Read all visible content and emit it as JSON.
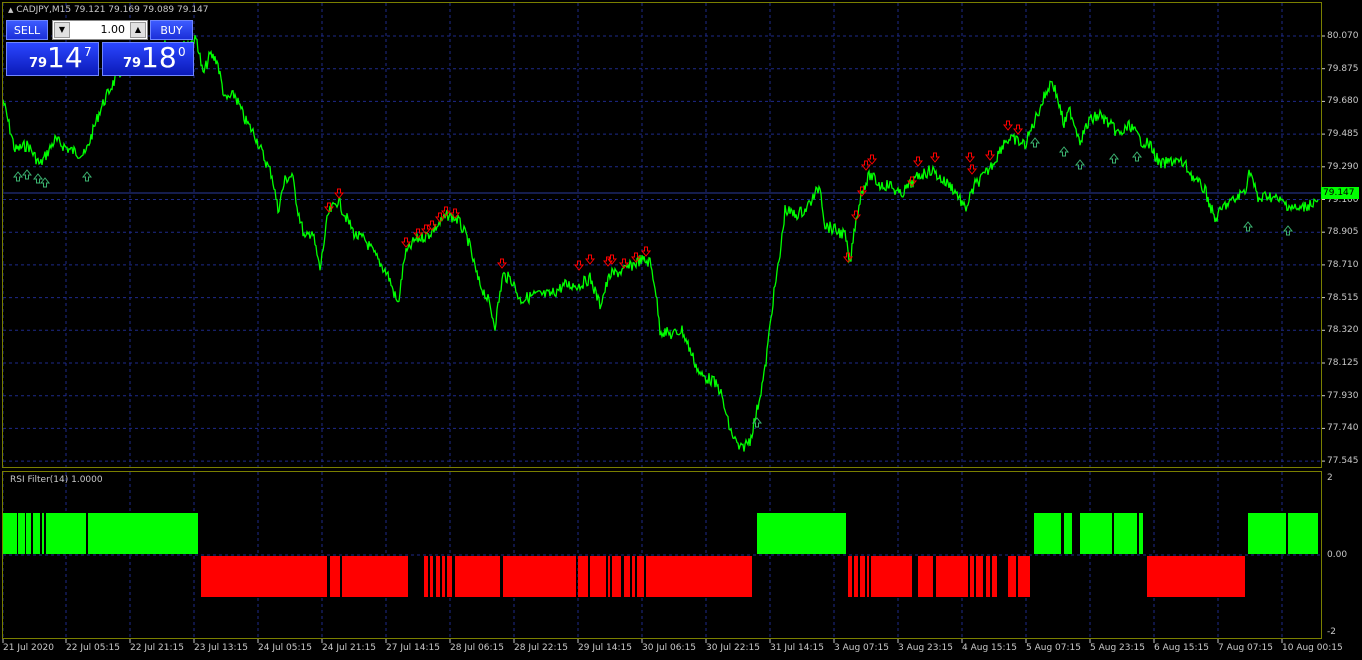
{
  "chart": {
    "title": "CADJPY,M15  79.121 79.169 79.089 79.147",
    "current_price": "79.147",
    "indicator_title": "RSI Filter(14) 1.0000",
    "price_axis": [
      "80.070",
      "79.875",
      "79.680",
      "79.485",
      "79.290",
      "79.100",
      "78.905",
      "78.710",
      "78.515",
      "78.320",
      "78.125",
      "77.930",
      "77.740",
      "77.545"
    ],
    "indicator_axis": [
      "2",
      "0.00",
      "-2"
    ],
    "time_axis": [
      "21 Jul 2020",
      "22 Jul 05:15",
      "22 Jul 21:15",
      "23 Jul 13:15",
      "24 Jul 05:15",
      "24 Jul 21:15",
      "27 Jul 14:15",
      "28 Jul 06:15",
      "28 Jul 22:15",
      "29 Jul 14:15",
      "30 Jul 06:15",
      "30 Jul 22:15",
      "31 Jul 14:15",
      "3 Aug 07:15",
      "3 Aug 23:15",
      "4 Aug 15:15",
      "5 Aug 07:15",
      "5 Aug 23:15",
      "6 Aug 15:15",
      "7 Aug 07:15",
      "10 Aug 00:15"
    ],
    "colors": {
      "price_line": "#00ff00",
      "buy_arrow": "#3cb371",
      "sell_arrow": "#ff0000",
      "bar_up": "#00ff00",
      "bar_down": "#ff0000",
      "grid": "#1e2a8a",
      "frame": "#7a7f00"
    }
  },
  "trade_panel": {
    "sell_label": "SELL",
    "buy_label": "BUY",
    "lot": "1.00",
    "sell_prefix": "79",
    "sell_big": "14",
    "sell_sup": "7",
    "buy_prefix": "79",
    "buy_big": "18",
    "buy_sup": "0"
  }
}
